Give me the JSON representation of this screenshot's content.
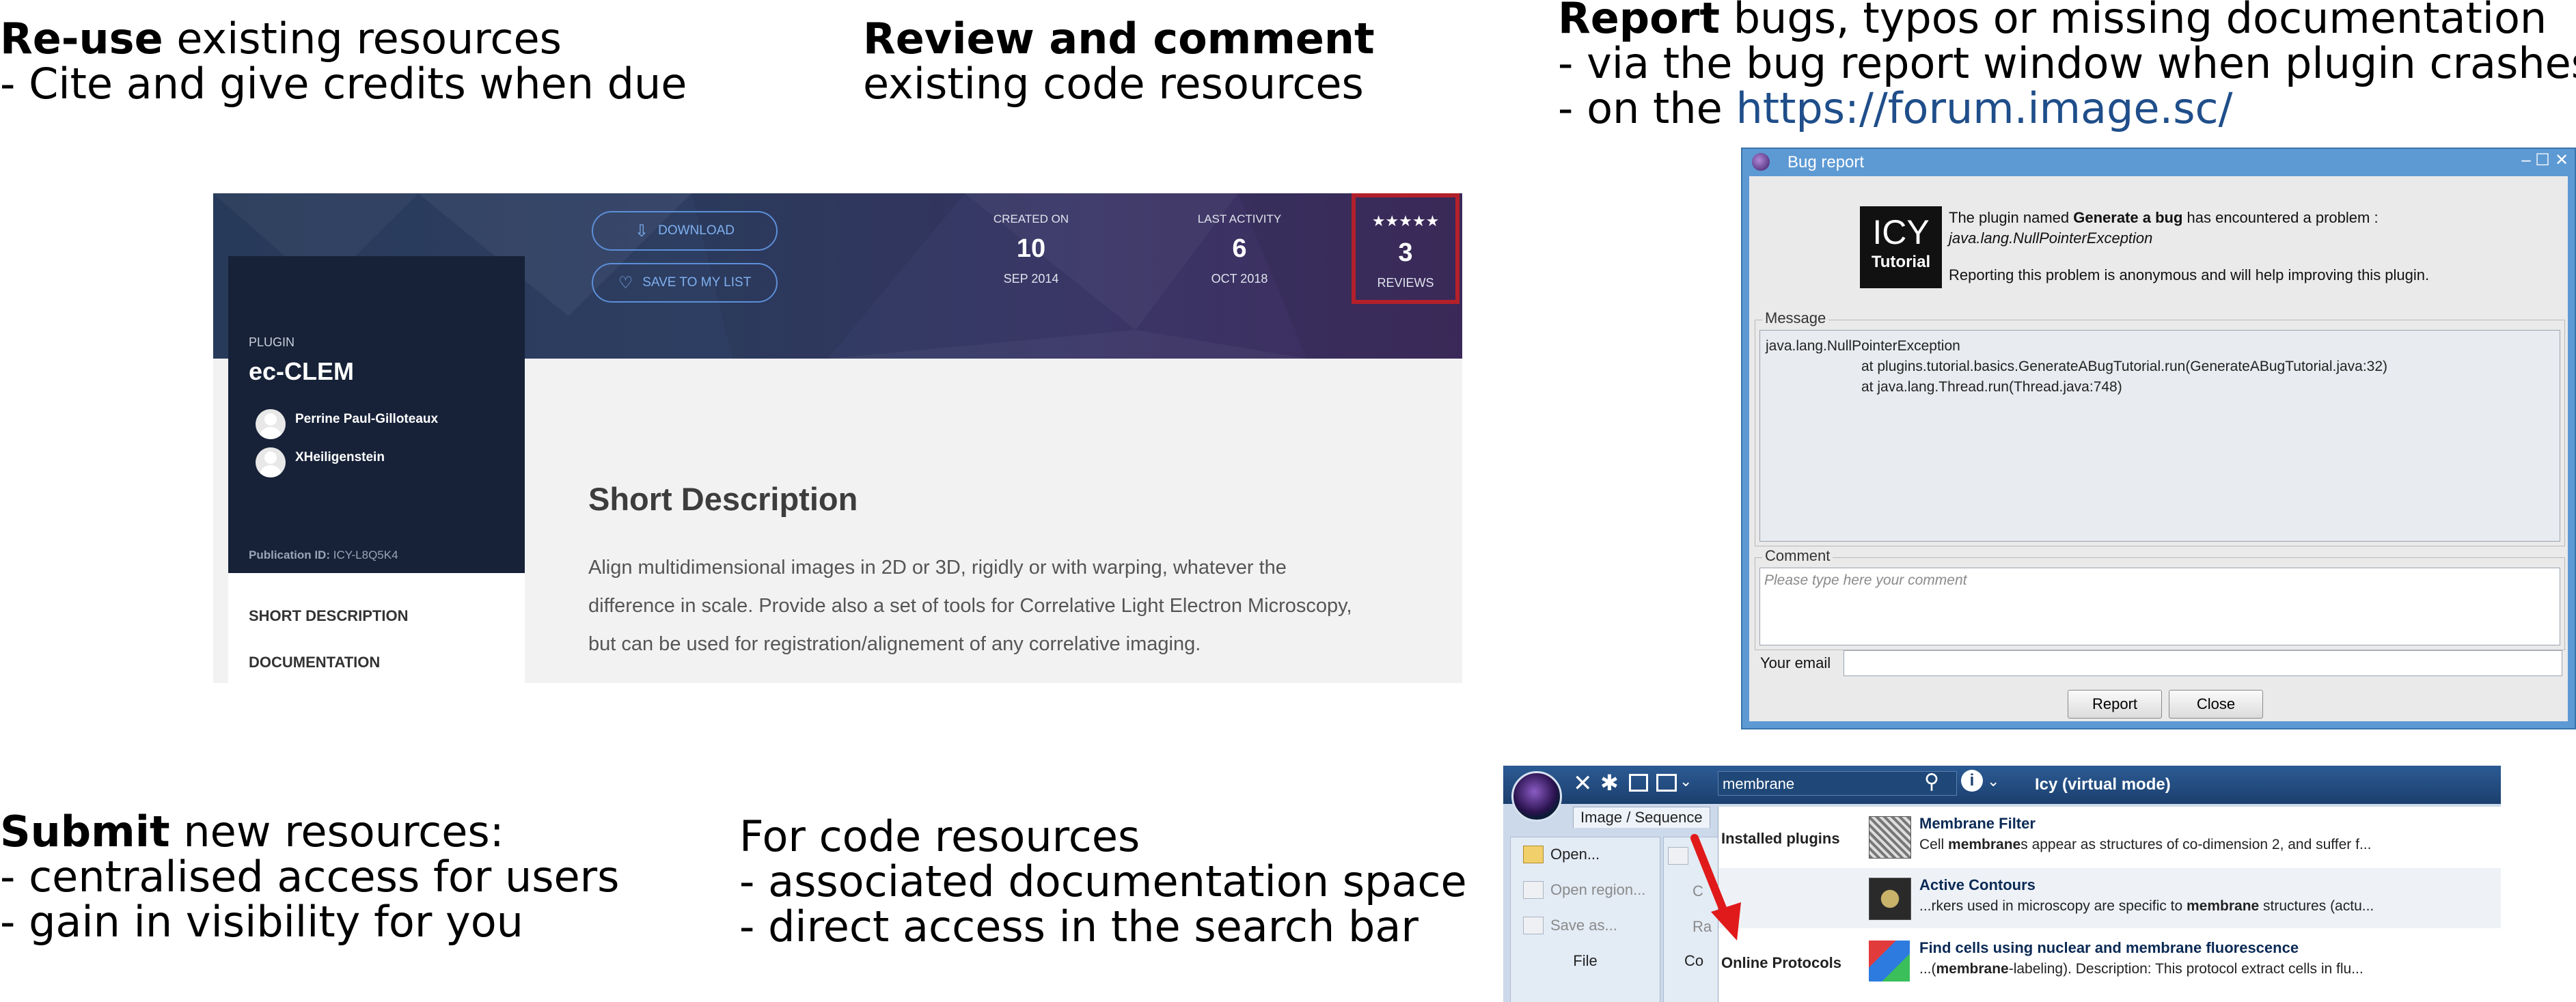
{
  "colors": {
    "link": "#1f4e8a",
    "highlight_box": "#b3202a",
    "arrow": "#e01a1a"
  },
  "blocks": {
    "reuse": {
      "bold": "Re-use",
      "rest": " existing resources",
      "line2": "- Cite and give credits when due"
    },
    "review": {
      "bold": "Review and comment",
      "line2": "existing code resources"
    },
    "report": {
      "bold": "Report",
      "rest": " bugs, typos or missing documentation",
      "line2": "- via the bug report window when plugin crashes",
      "line3_prefix": "- on the ",
      "line3_link": "https://forum.image.sc/"
    },
    "submit": {
      "bold": "Submit",
      "rest": " new resources:",
      "line2": "- centralised access for users",
      "line3": "- gain in visibility for you"
    },
    "code": {
      "line1": "For code resources",
      "line2": "- associated documentation space",
      "line3": "- direct access in the search bar"
    }
  },
  "plugin_page": {
    "download_label": "DOWNLOAD",
    "save_label": "SAVE TO MY LIST",
    "created": {
      "label": "CREATED ON",
      "value": "10",
      "sub": "SEP 2014"
    },
    "activity": {
      "label": "LAST ACTIVITY",
      "value": "6",
      "sub": "OCT 2018"
    },
    "reviews": {
      "stars": "★★★★★",
      "value": "3",
      "sub": "REVIEWS"
    },
    "category": "PLUGIN",
    "name": "ec-CLEM",
    "authors": [
      "Perrine Paul-Gilloteaux",
      "XHeiligenstein"
    ],
    "publication_id_label": "Publication ID:",
    "publication_id": "ICY-L8Q5K4",
    "nav": [
      "SHORT DESCRIPTION",
      "DOCUMENTATION"
    ],
    "section_title": "Short Description",
    "description": [
      "Align multidimensional images in 2D or 3D, rigidly or with warping, whatever the",
      "difference in scale. Provide also a set of tools for Correlative Light Electron Microscopy,",
      "but can be used for registration/alignement of any correlative imaging."
    ]
  },
  "bug_report": {
    "title": "Bug report",
    "logo_top": "ICY",
    "logo_bottom": "Tutorial",
    "intro_prefix": "The plugin named ",
    "plugin_name": "Generate a bug",
    "intro_suffix": " has encountered a problem :",
    "exception": "java.lang.NullPointerException",
    "anonymous_note": "Reporting this problem is anonymous and will help improving this plugin.",
    "message_label": "Message",
    "message_lines": [
      "java.lang.NullPointerException",
      "at plugins.tutorial.basics.GenerateABugTutorial.run(GenerateABugTutorial.java:32)",
      "at java.lang.Thread.run(Thread.java:748)"
    ],
    "comment_label": "Comment",
    "comment_placeholder": "Please type here your comment",
    "email_label": "Your email",
    "report_button": "Report",
    "close_button": "Close"
  },
  "icy_search": {
    "search_value": "membrane",
    "app_title": "Icy (virtual mode)",
    "tab": "Image / Sequence",
    "menu": [
      "Open...",
      "Open region...",
      "Save as..."
    ],
    "group_label": "File",
    "partial_group": "Co",
    "partial_items": [
      "C",
      "Ra"
    ],
    "results": [
      {
        "category": "Installed plugins",
        "title": "Membrane Filter",
        "desc_parts": [
          "Cell ",
          "membrane",
          "s appear as structures of co-dimension 2, and suffer f..."
        ]
      },
      {
        "category": "",
        "title": "Active Contours",
        "desc_parts": [
          "...rkers used in microscopy are specific to ",
          "membrane",
          " structures (actu..."
        ]
      },
      {
        "category": "Online Protocols",
        "title": "Find cells using nuclear and membrane fluorescence",
        "desc_parts": [
          "...(",
          "membrane",
          "-labeling). Description: This protocol extract cells in flu..."
        ]
      }
    ]
  }
}
